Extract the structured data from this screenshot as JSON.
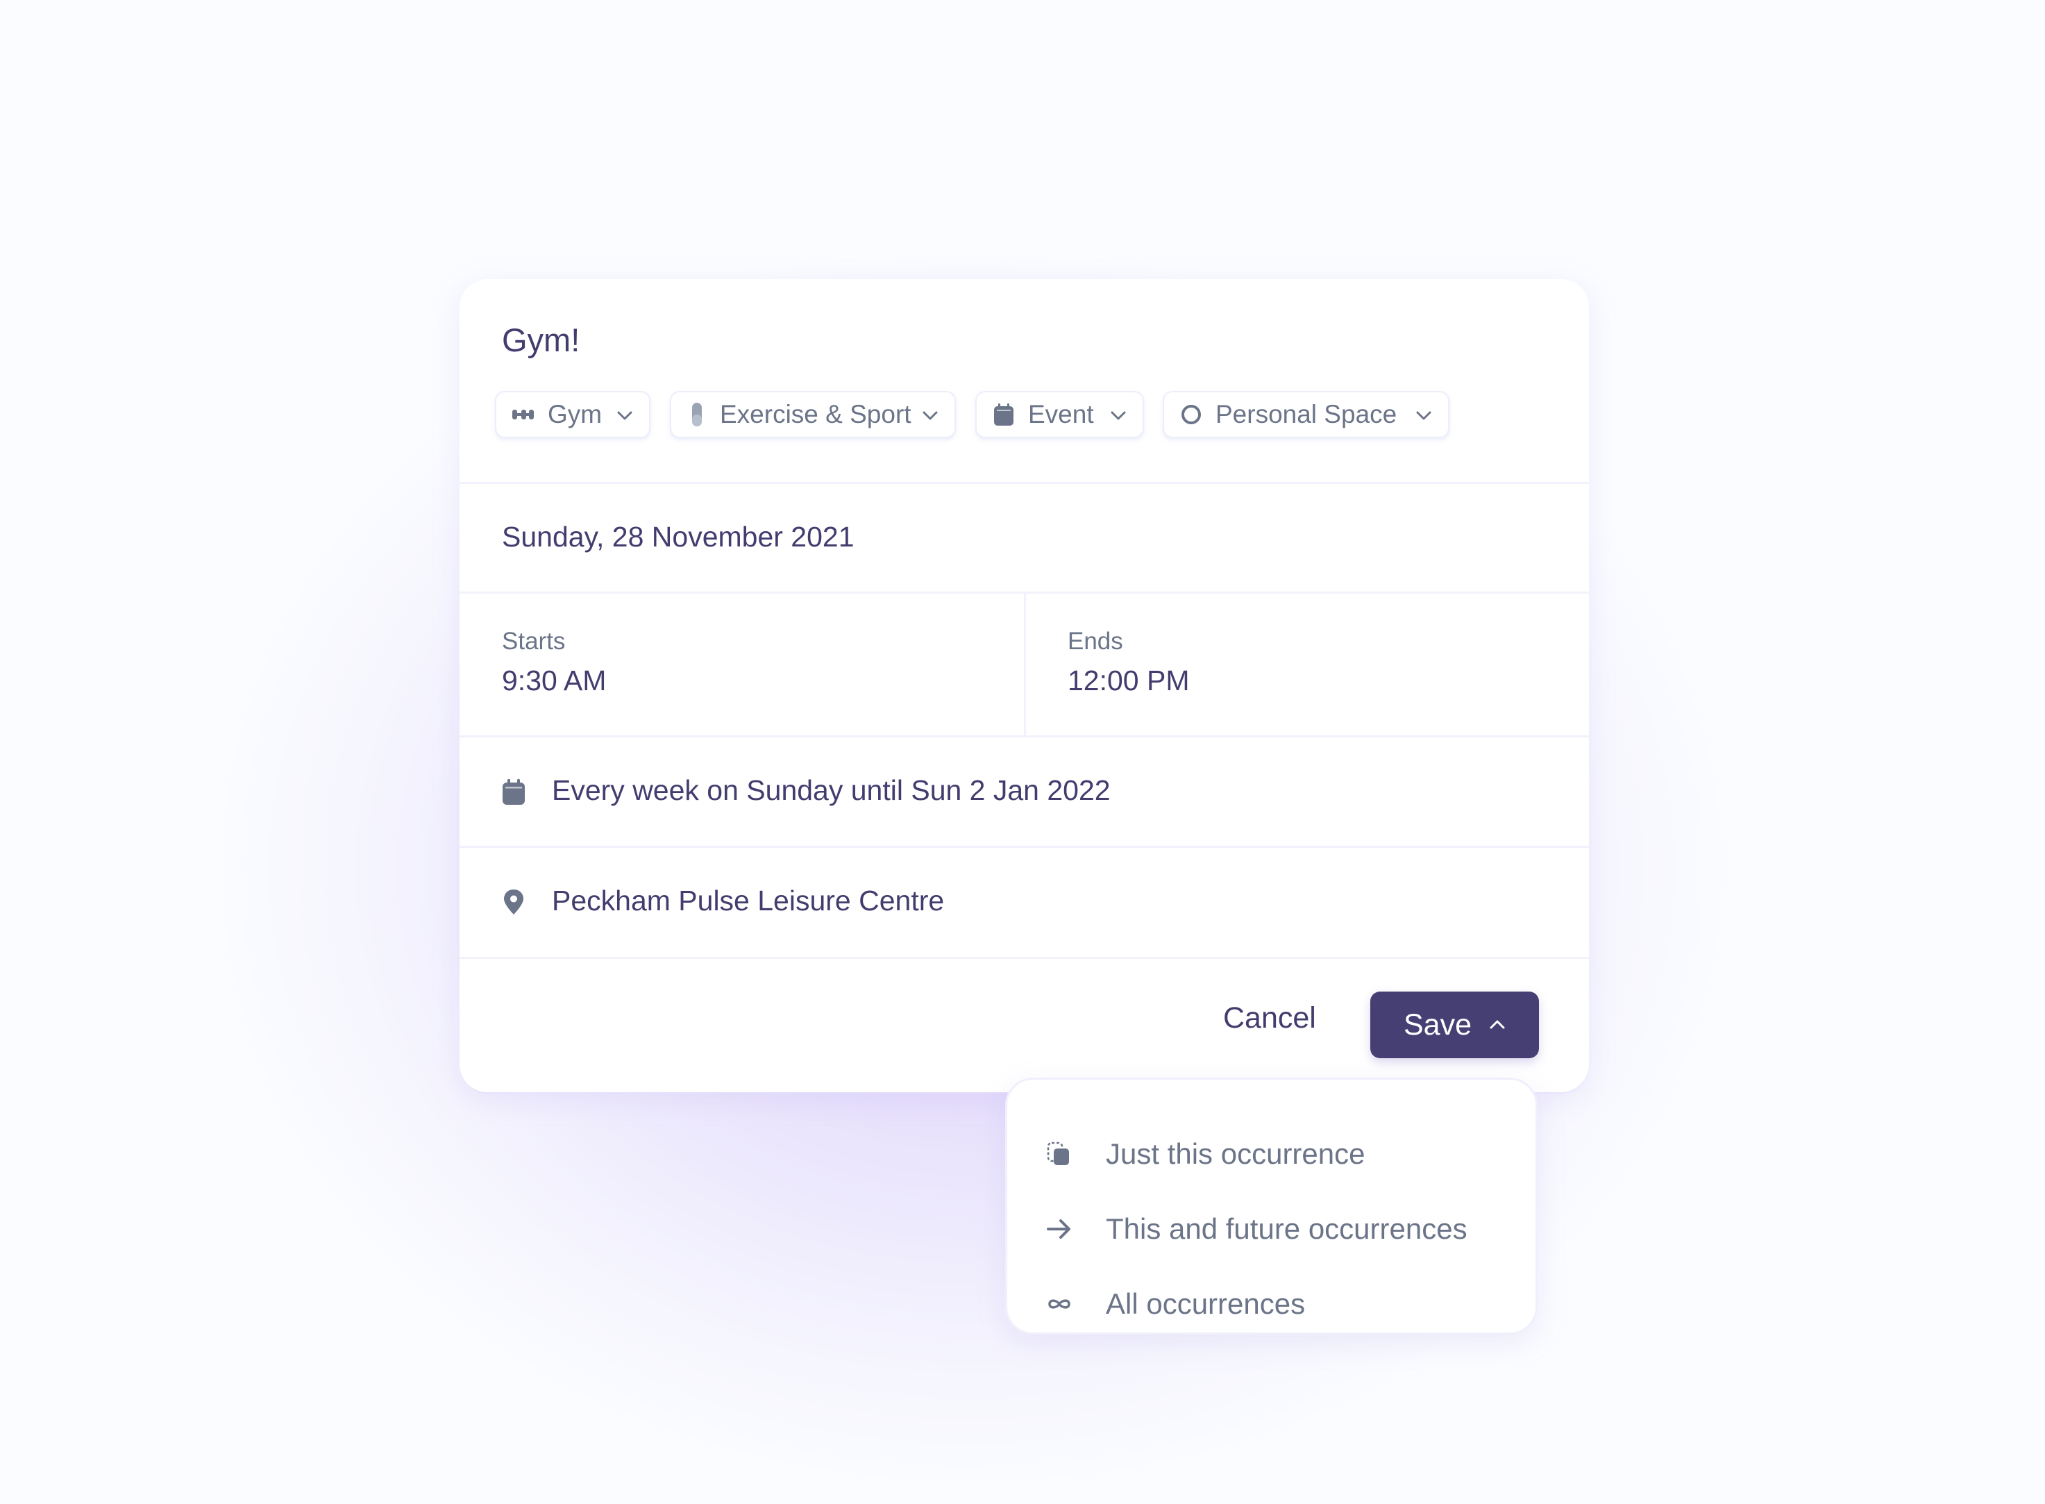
{
  "event": {
    "title": "Gym!",
    "tags": [
      {
        "label": "Gym",
        "icon": "dumbbell-icon"
      },
      {
        "label": "Exercise & Sport",
        "icon": "color-pill-icon"
      },
      {
        "label": "Event",
        "icon": "calendar-icon"
      },
      {
        "label": "Personal Space",
        "icon": "circle-icon"
      }
    ],
    "date": "Sunday, 28 November 2021",
    "starts_label": "Starts",
    "starts_value": "9:30 AM",
    "ends_label": "Ends",
    "ends_value": "12:00 PM",
    "recurrence": "Every week on Sunday until Sun 2 Jan 2022",
    "location": "Peckham Pulse Leisure Centre"
  },
  "actions": {
    "cancel_label": "Cancel",
    "save_label": "Save"
  },
  "save_menu": {
    "items": [
      {
        "label": "Just this occurrence",
        "icon": "single-occurrence-icon"
      },
      {
        "label": "This and future occurrences",
        "icon": "arrow-right-icon"
      },
      {
        "label": "All occurrences",
        "icon": "infinity-icon"
      }
    ]
  },
  "colors": {
    "primary": "#463f74",
    "text_primary": "#423d6e",
    "text_secondary": "#6b7488",
    "icon": "#6b7488",
    "divider": "#f1f2fc"
  }
}
